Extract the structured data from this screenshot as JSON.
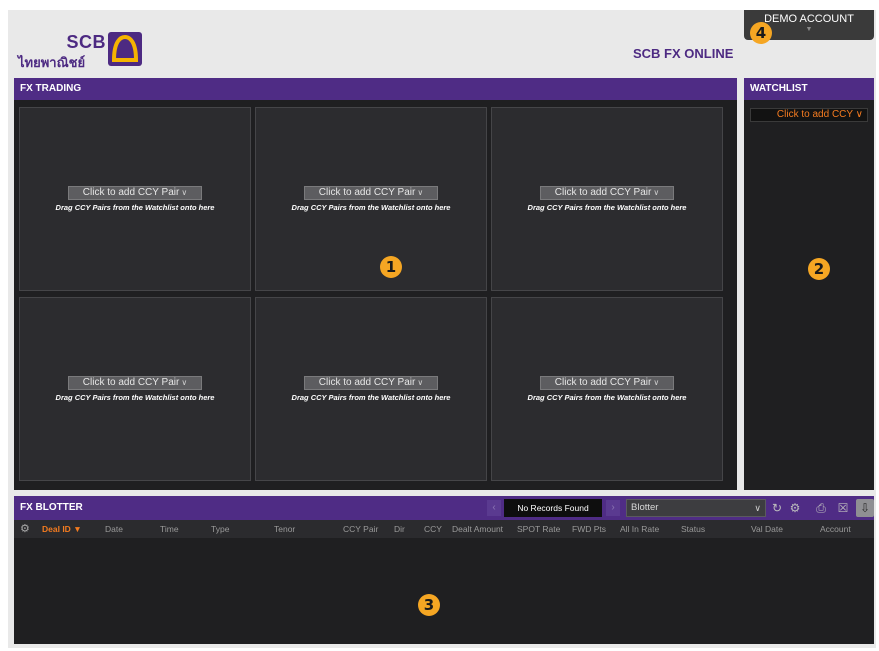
{
  "header": {
    "logo_en": "SCB",
    "logo_th": "ไทยพาณิชย์",
    "brand_title": "SCB FX ONLINE",
    "account_label": "DEMO ACCOUNT"
  },
  "badges": [
    "1",
    "2",
    "3",
    "4"
  ],
  "fx_trading": {
    "title": "FX TRADING",
    "tiles": [
      {
        "select_label": "Click to add CCY Pair",
        "hint": "Drag CCY Pairs from the Watchlist onto here"
      },
      {
        "select_label": "Click to add CCY Pair",
        "hint": "Drag CCY Pairs from the Watchlist onto here"
      },
      {
        "select_label": "Click to add CCY Pair",
        "hint": "Drag CCY Pairs from the Watchlist onto here"
      },
      {
        "select_label": "Click to add CCY Pair",
        "hint": "Drag CCY Pairs from the Watchlist onto here"
      },
      {
        "select_label": "Click to add CCY Pair",
        "hint": "Drag CCY Pairs from the Watchlist onto here"
      },
      {
        "select_label": "Click to add CCY Pair",
        "hint": "Drag CCY Pairs from the Watchlist onto here"
      }
    ]
  },
  "watchlist": {
    "title": "WATCHLIST",
    "select_label": "Click to add CCY"
  },
  "blotter": {
    "title": "FX BLOTTER",
    "records_status": "No Records Found",
    "view_select": "Blotter",
    "columns": [
      "Deal ID",
      "Date",
      "Time",
      "Type",
      "Tenor",
      "CCY Pair",
      "Dir",
      "CCY",
      "Dealt Amount",
      "SPOT Rate",
      "FWD Pts",
      "All In Rate",
      "Status",
      "Val Date",
      "Account"
    ],
    "sorted_column": "Deal ID"
  },
  "colors": {
    "brand_purple": "#4f2c85",
    "accent_orange": "#f47b20",
    "badge": "#f5a623",
    "panel_dark": "#1f1f21"
  },
  "icons": [
    "chevron-down-icon",
    "settings-gear-icon",
    "sort-desc-icon",
    "refresh-icon",
    "print-icon",
    "excel-export-icon",
    "download-icon"
  ]
}
